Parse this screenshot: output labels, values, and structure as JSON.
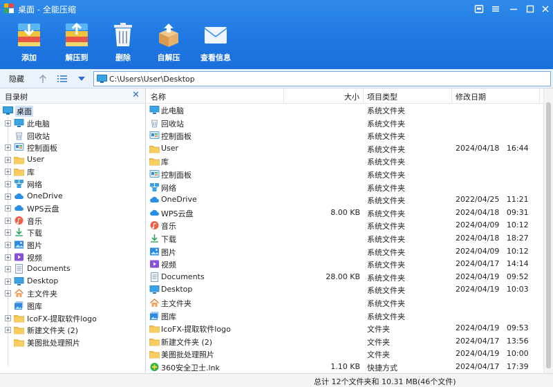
{
  "window": {
    "title": "桌面 - 全能压缩"
  },
  "toolbar": {
    "items": [
      {
        "label": "添加",
        "icon": "add-archive-icon"
      },
      {
        "label": "解压到",
        "icon": "extract-to-icon"
      },
      {
        "label": "删除",
        "icon": "trash-icon"
      },
      {
        "label": "自解压",
        "icon": "self-extract-icon"
      },
      {
        "label": "查看信息",
        "icon": "info-envelope-icon"
      }
    ]
  },
  "addressbar": {
    "hide_label": "隐藏",
    "path": "C:\\Users\\User\\Desktop"
  },
  "tree": {
    "title": "目录树",
    "close_glyph": "✕",
    "root": "桌面",
    "items": [
      {
        "label": "此电脑",
        "icon": "pc-icon",
        "expander": true
      },
      {
        "label": "回收站",
        "icon": "recycle-bin-icon",
        "expander": false
      },
      {
        "label": "控制面板",
        "icon": "control-panel-icon",
        "expander": true
      },
      {
        "label": "User",
        "icon": "folder-icon",
        "expander": true
      },
      {
        "label": "库",
        "icon": "folder-icon",
        "expander": true
      },
      {
        "label": "网络",
        "icon": "network-icon",
        "expander": true
      },
      {
        "label": "OneDrive",
        "icon": "cloud-icon",
        "expander": true
      },
      {
        "label": "WPS云盘",
        "icon": "cloud-icon",
        "expander": true
      },
      {
        "label": "音乐",
        "icon": "music-icon",
        "expander": true
      },
      {
        "label": "下载",
        "icon": "download-icon",
        "expander": true
      },
      {
        "label": "图片",
        "icon": "picture-icon",
        "expander": true
      },
      {
        "label": "视频",
        "icon": "video-icon",
        "expander": true
      },
      {
        "label": "Documents",
        "icon": "documents-icon",
        "expander": true
      },
      {
        "label": "Desktop",
        "icon": "desktop-icon",
        "expander": true
      },
      {
        "label": "主文件夹",
        "icon": "home-icon",
        "expander": true
      },
      {
        "label": "图库",
        "icon": "gallery-icon",
        "expander": false
      },
      {
        "label": "IcoFX-提取软件logo",
        "icon": "folder-icon",
        "expander": true
      },
      {
        "label": "新建文件夹 (2)",
        "icon": "folder-icon",
        "expander": true
      },
      {
        "label": "美图批处理照片",
        "icon": "folder-icon",
        "expander": false
      }
    ]
  },
  "list": {
    "columns": {
      "name": "名称",
      "size": "大小",
      "type": "项目类型",
      "date": "修改日期"
    },
    "rows": [
      {
        "name": "此电脑",
        "size": "",
        "type": "系统文件夹",
        "date": "",
        "icon": "pc-icon"
      },
      {
        "name": "回收站",
        "size": "",
        "type": "系统文件夹",
        "date": "",
        "icon": "recycle-bin-icon"
      },
      {
        "name": "控制面板",
        "size": "",
        "type": "系统文件夹",
        "date": "",
        "icon": "control-panel-icon"
      },
      {
        "name": "User",
        "size": "",
        "type": "系统文件夹",
        "date": "2024/04/18   16:44",
        "icon": "folder-icon"
      },
      {
        "name": "库",
        "size": "",
        "type": "系统文件夹",
        "date": "",
        "icon": "folder-icon"
      },
      {
        "name": "控制面板",
        "size": "",
        "type": "系统文件夹",
        "date": "",
        "icon": "control-panel-icon"
      },
      {
        "name": "网络",
        "size": "",
        "type": "系统文件夹",
        "date": "",
        "icon": "network-icon"
      },
      {
        "name": "OneDrive",
        "size": "",
        "type": "系统文件夹",
        "date": "2022/04/25   11:21",
        "icon": "cloud-icon"
      },
      {
        "name": "WPS云盘",
        "size": "8.00 KB",
        "type": "系统文件夹",
        "date": "2024/04/18   09:31",
        "icon": "cloud-icon"
      },
      {
        "name": "音乐",
        "size": "",
        "type": "系统文件夹",
        "date": "2024/04/09   10:12",
        "icon": "music-icon"
      },
      {
        "name": "下载",
        "size": "",
        "type": "系统文件夹",
        "date": "2024/04/18   18:27",
        "icon": "download-icon"
      },
      {
        "name": "图片",
        "size": "",
        "type": "系统文件夹",
        "date": "2024/04/09   10:12",
        "icon": "picture-icon"
      },
      {
        "name": "视频",
        "size": "",
        "type": "系统文件夹",
        "date": "2024/04/17   14:14",
        "icon": "video-icon"
      },
      {
        "name": "Documents",
        "size": "28.00 KB",
        "type": "系统文件夹",
        "date": "2024/04/19   09:52",
        "icon": "documents-icon"
      },
      {
        "name": "Desktop",
        "size": "",
        "type": "系统文件夹",
        "date": "2024/04/19   10:03",
        "icon": "desktop-icon"
      },
      {
        "name": "主文件夹",
        "size": "",
        "type": "系统文件夹",
        "date": "",
        "icon": "home-icon"
      },
      {
        "name": "图库",
        "size": "",
        "type": "系统文件夹",
        "date": "",
        "icon": "gallery-icon"
      },
      {
        "name": "IcoFX-提取软件logo",
        "size": "",
        "type": "文件夹",
        "date": "2024/04/19   09:53",
        "icon": "folder-icon"
      },
      {
        "name": "新建文件夹 (2)",
        "size": "",
        "type": "文件夹",
        "date": "2024/04/17   13:56",
        "icon": "folder-icon"
      },
      {
        "name": "美图批处理照片",
        "size": "",
        "type": "文件夹",
        "date": "2024/04/19   10:00",
        "icon": "folder-icon"
      },
      {
        "name": "360安全卫士.lnk",
        "size": "1.10 KB",
        "type": "快捷方式",
        "date": "2024/04/17   17:39",
        "icon": "shortcut-360-icon"
      }
    ]
  },
  "status": {
    "text": "总计 12个文件夹和 10.31 MB(46个文件)"
  },
  "colors": {
    "header_blue": "#1f78e3",
    "folder_yellow": "#f5c04a",
    "selection": "#cfe3fa"
  }
}
